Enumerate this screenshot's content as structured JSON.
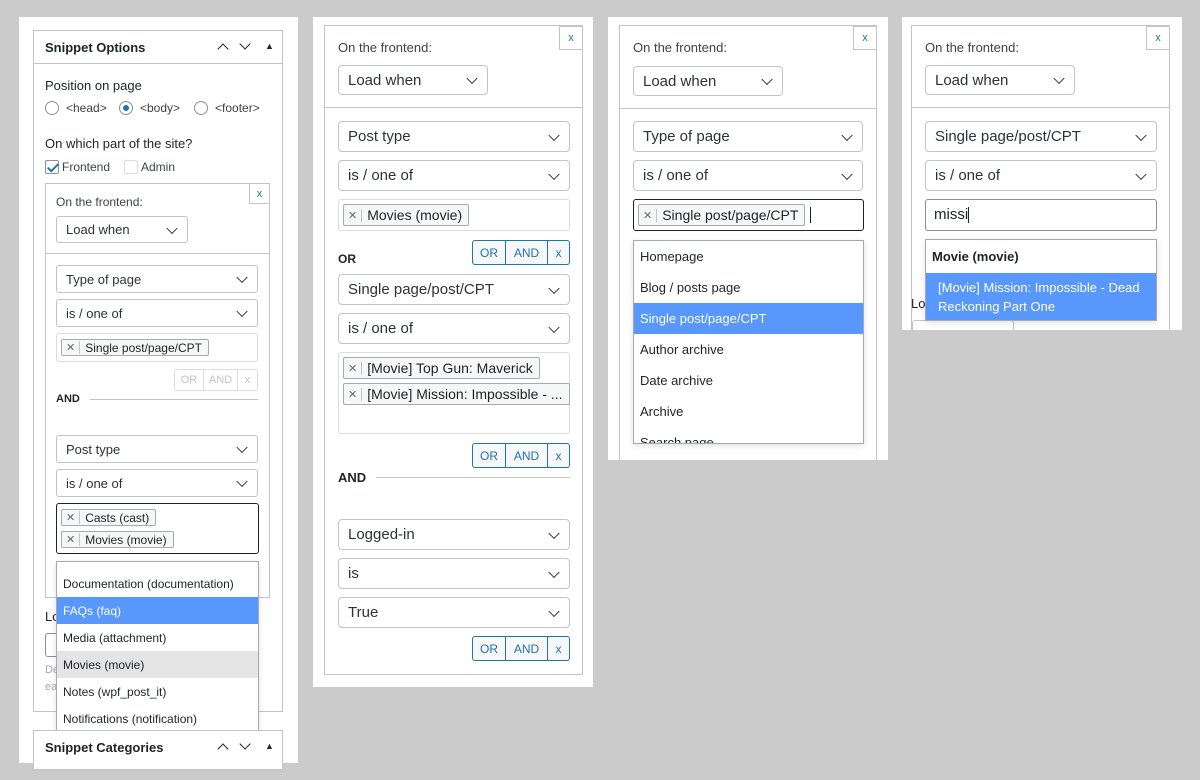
{
  "panel1": {
    "title": "Snippet Options",
    "position_label": "Position on page",
    "radio_head": "<head>",
    "radio_body": "<body>",
    "radio_footer": "<footer>",
    "site_part_label": "On which part of the site?",
    "frontend_label": "Frontend",
    "admin_label": "Admin",
    "on_frontend": "On the frontend:",
    "load_when": "Load when",
    "close": "x",
    "type_of_page": "Type of page",
    "is_one_of": "is / one of",
    "tag_single": "Single post/page/CPT",
    "or": "OR",
    "and": "AND",
    "x": "x",
    "and_divider": "AND",
    "post_type": "Post type",
    "is_one_of_2": "is / one of",
    "tag_casts": "Casts (cast)",
    "tag_movies": "Movies (movie)",
    "dropdown": [
      "Documentation (documentation)",
      "FAQs (faq)",
      "Media (attachment)",
      "Movies (movie)",
      "Notes (wpf_post_it)",
      "Notifications (notification)"
    ],
    "partial_lo": "Lo",
    "partial_de": "De",
    "partial_ea": "ea",
    "categories_title": "Snippet Categories"
  },
  "panel2": {
    "on_frontend": "On the frontend:",
    "load_when": "Load when",
    "close": "x",
    "post_type": "Post type",
    "is_one_of": "is / one of",
    "tag_movies": "Movies (movie)",
    "or": "OR",
    "and": "AND",
    "x": "x",
    "or_divider": "OR",
    "single": "Single page/post/CPT",
    "is_one_of_2": "is / one of",
    "tag_topgun": "[Movie] Top Gun: Maverick",
    "tag_mission": "[Movie] Mission: Impossible - ...",
    "and_divider": "AND",
    "logged_in": "Logged-in",
    "is": "is",
    "true_val": "True"
  },
  "panel3": {
    "on_frontend": "On the frontend:",
    "load_when": "Load when",
    "close": "x",
    "type_of_page": "Type of page",
    "is_one_of": "is / one of",
    "tag_single": "Single post/page/CPT",
    "dropdown": [
      "Homepage",
      "Blog / posts page",
      "Single post/page/CPT",
      "Author archive",
      "Date archive",
      "Archive",
      "Search page"
    ]
  },
  "panel4": {
    "on_frontend": "On the frontend:",
    "load_when": "Load when",
    "close": "x",
    "single": "Single page/post/CPT",
    "is_one_of": "is / one of",
    "search_value": "missi",
    "group_header": "Movie (movie)",
    "result": "[Movie] Mission: Impossible - Dead Reckoning Part One",
    "partial_lo": "Lo"
  },
  "colors": {
    "accent": "#2271b1",
    "highlight": "#5897fb",
    "background": "#cbcbcb"
  }
}
